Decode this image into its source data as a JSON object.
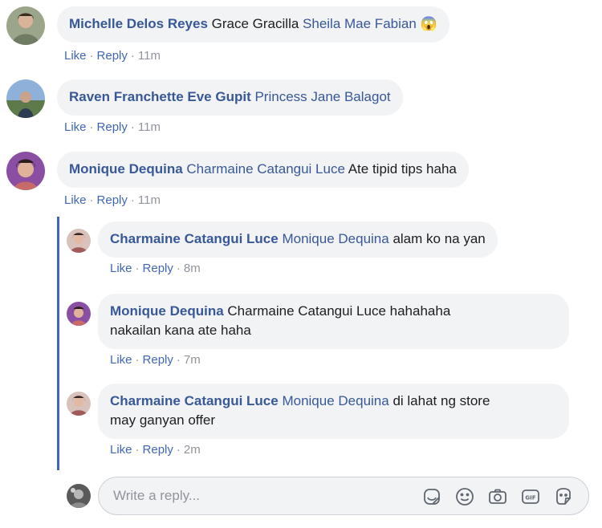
{
  "comments": [
    {
      "name": "Michelle Delos Reyes",
      "text_plain": "Grace Gracilla",
      "tag": "Sheila Mae Fabian",
      "emoji": "😱",
      "like": "Like",
      "reply": "Reply",
      "time": "11m"
    },
    {
      "name": "Raven Franchette Eve Gupit",
      "tag": "Princess Jane Balagot",
      "like": "Like",
      "reply": "Reply",
      "time": "11m"
    },
    {
      "name": "Monique Dequina",
      "tag": "Charmaine Catangui Luce",
      "text": "Ate tipid tips haha",
      "like": "Like",
      "reply": "Reply",
      "time": "11m"
    }
  ],
  "replies": [
    {
      "name": "Charmaine Catangui Luce",
      "tag": "Monique Dequina",
      "text": "alam ko na yan",
      "like": "Like",
      "reply": "Reply",
      "time": "8m"
    },
    {
      "name": "Monique Dequina",
      "text_line1": "Charmaine Catangui Luce hahahaha",
      "text_line2": "nakailan kana ate haha",
      "like": "Like",
      "reply": "Reply",
      "time": "7m"
    },
    {
      "name": "Charmaine Catangui Luce",
      "tag": "Monique Dequina",
      "text_line1": "di lahat ng store",
      "text_line2": "may ganyan offer",
      "like": "Like",
      "reply": "Reply",
      "time": "2m"
    }
  ],
  "composer": {
    "placeholder": "Write a reply...",
    "icons": [
      "sticker-icon",
      "emoji-icon",
      "camera-icon",
      "gif-icon",
      "avatar-sticker-icon"
    ]
  },
  "colors": {
    "link": "#385898",
    "action": "#4267b2",
    "bubble": "#f2f3f5",
    "thread_line": "#4267b2"
  }
}
